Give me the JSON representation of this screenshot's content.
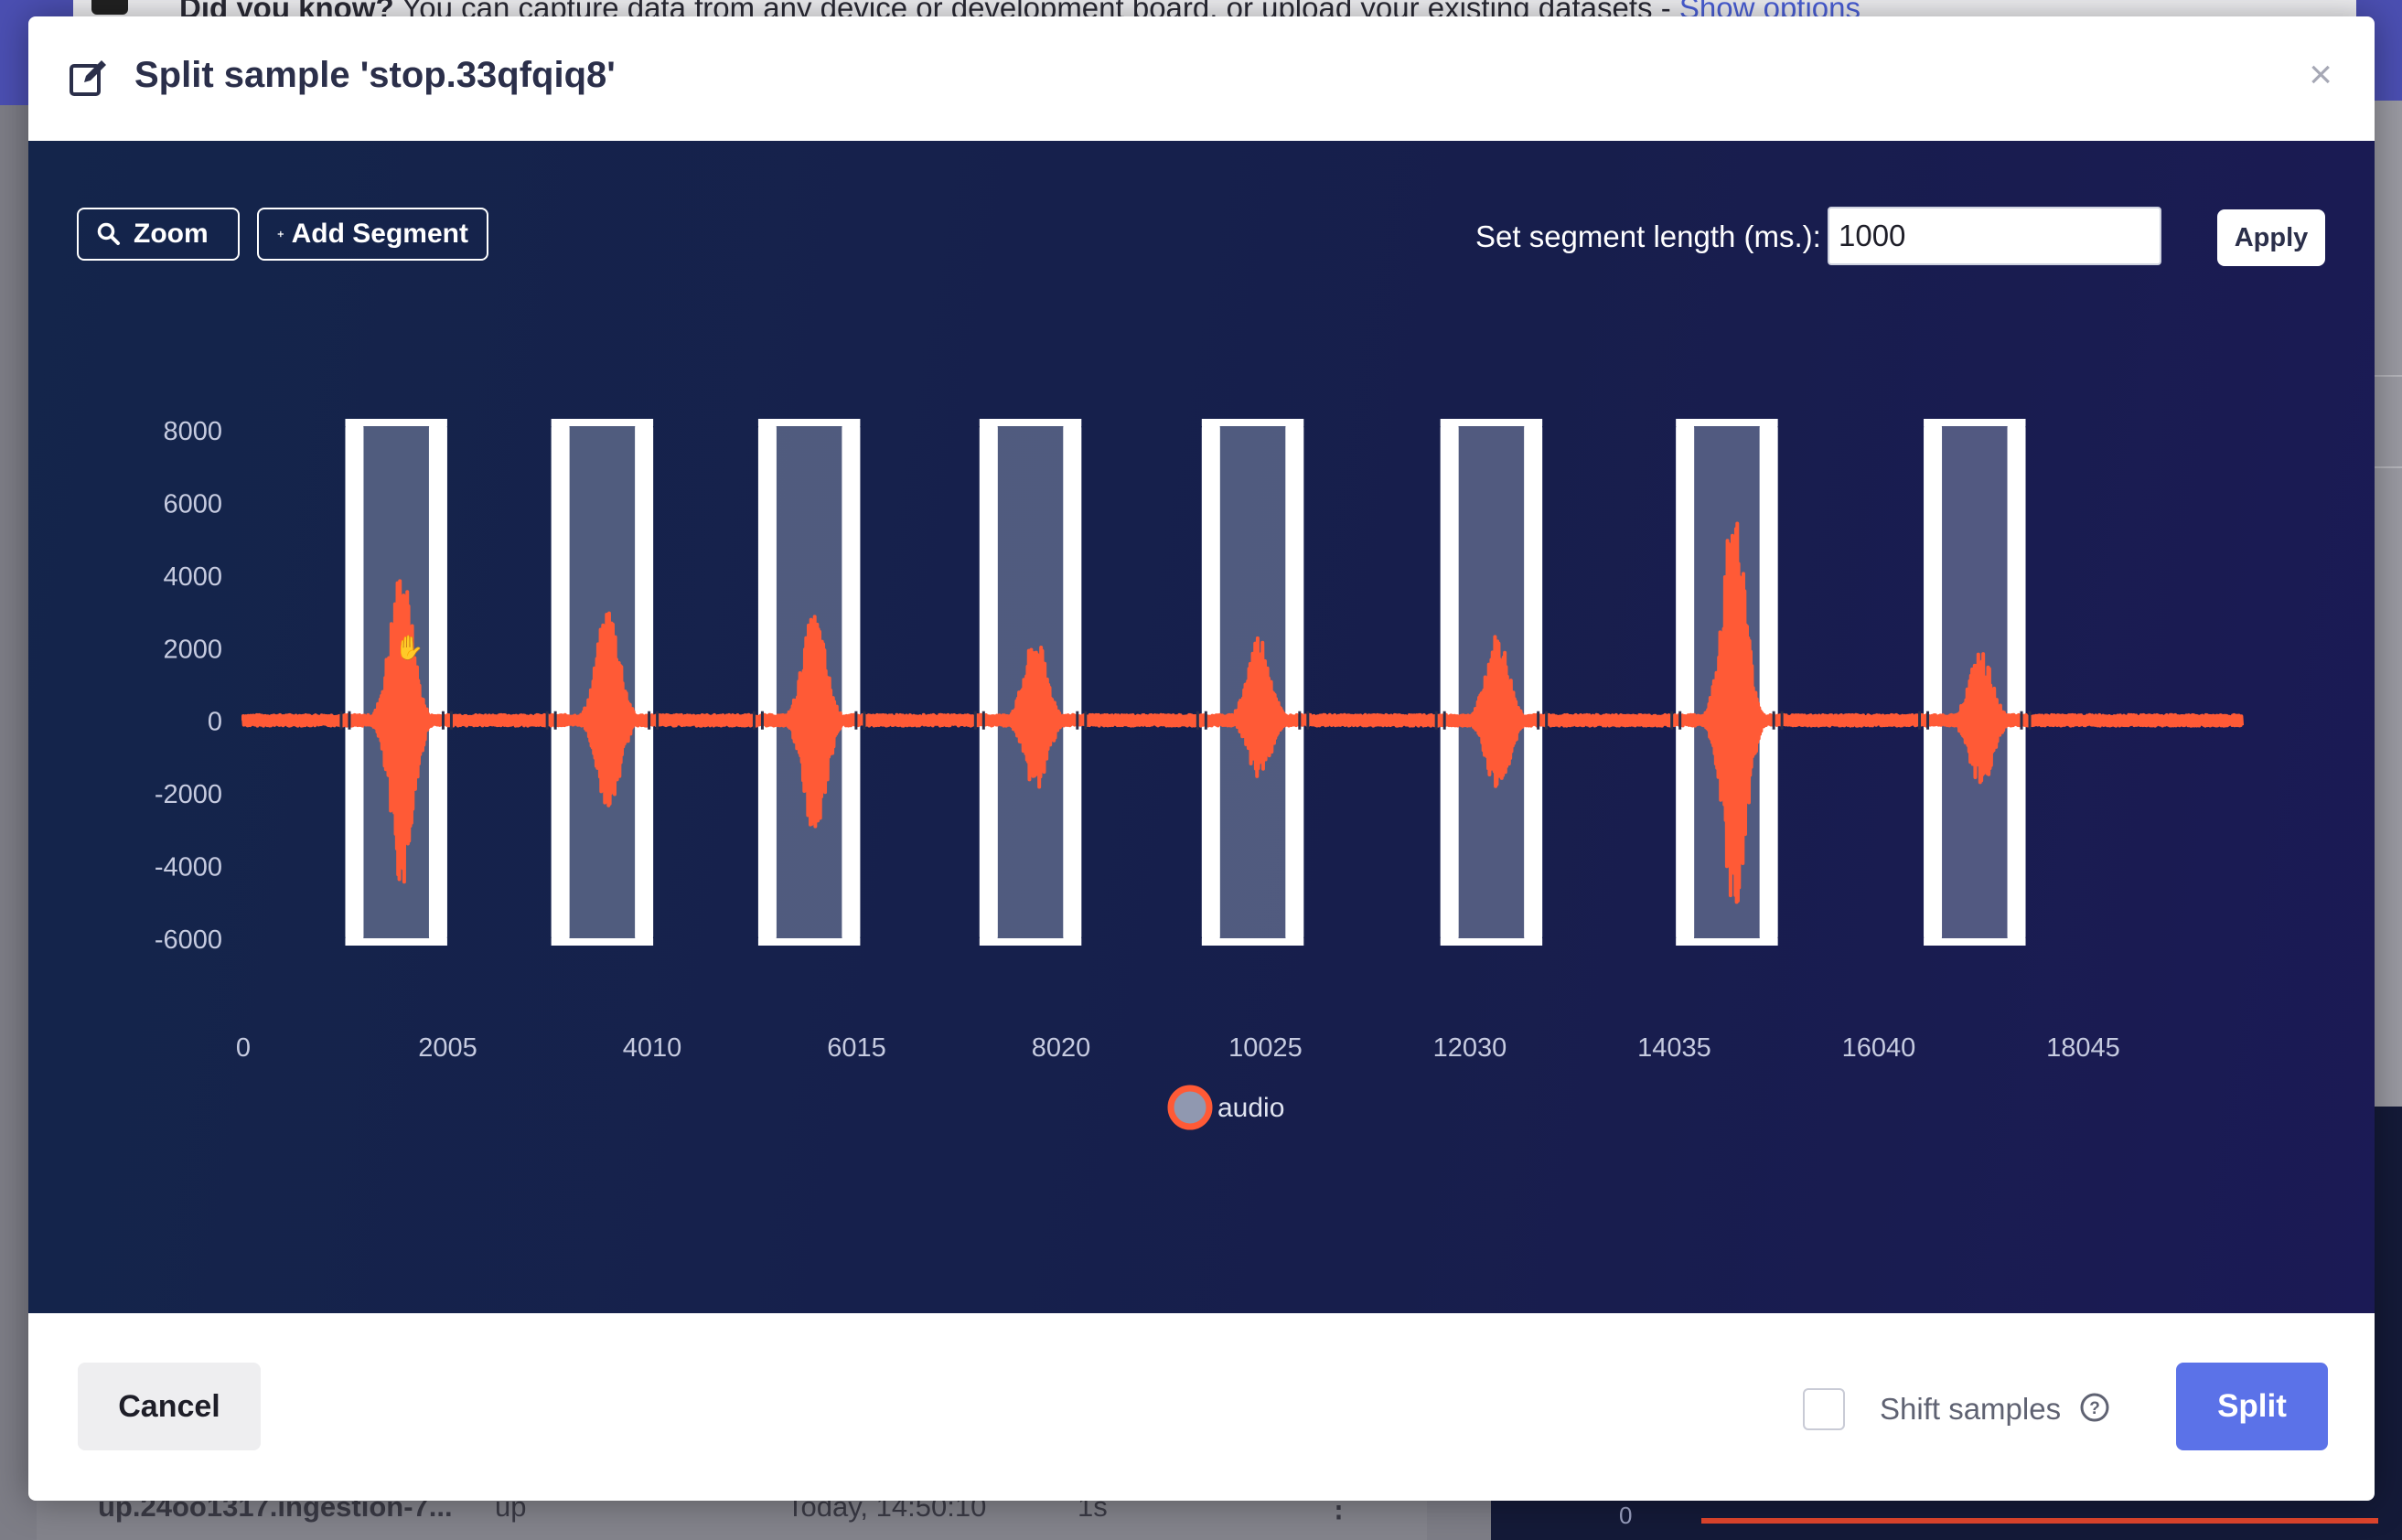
{
  "background": {
    "notice_bold": "Did you know?",
    "notice_text": " You can capture data from any device or development board, or upload your existing datasets - ",
    "notice_link": "Show options",
    "row": {
      "name": "up.24oo1317.ingestion-7...",
      "label": "up",
      "added": "Today, 14:50:10",
      "length": "1s"
    },
    "mini_chart_zero": "0"
  },
  "modal": {
    "title": "Split sample 'stop.33qfqiq8'",
    "close_label": "×",
    "edit_icon": "edit-icon",
    "toolbar": {
      "zoom_label": "Zoom",
      "zoom_icon": "search-icon",
      "add_segment_label": "Add Segment",
      "add_segment_icon": "plus-icon",
      "segment_length_label": "Set segment length (ms.):",
      "segment_length_value": "1000",
      "apply_label": "Apply"
    },
    "footer": {
      "cancel_label": "Cancel",
      "shift_samples_label": "Shift samples",
      "shift_samples_checked": false,
      "help_icon": "question-circle-icon",
      "split_label": "Split"
    }
  },
  "chart_data": {
    "type": "line",
    "series": [
      {
        "name": "audio",
        "color": "#ff5a36",
        "bursts": [
          {
            "x": 1550,
            "max": 4200,
            "min": -4600
          },
          {
            "x": 3580,
            "max": 3200,
            "min": -2500
          },
          {
            "x": 5600,
            "max": 3000,
            "min": -3300
          },
          {
            "x": 7770,
            "max": 2300,
            "min": -2000
          },
          {
            "x": 9960,
            "max": 2400,
            "min": -1600
          },
          {
            "x": 12300,
            "max": 2400,
            "min": -2000
          },
          {
            "x": 14620,
            "max": 6000,
            "min": -5400
          },
          {
            "x": 17040,
            "max": 1900,
            "min": -2000
          }
        ],
        "baseline_amplitude": 150
      }
    ],
    "x_ticks": [
      "0",
      "2005",
      "4010",
      "6015",
      "8020",
      "10025",
      "12030",
      "14035",
      "16040",
      "18045"
    ],
    "y_ticks": [
      "8000",
      "6000",
      "4000",
      "2000",
      "0",
      "-2000",
      "-4000",
      "-6000"
    ],
    "xlim": [
      0,
      20050
    ],
    "ylim": [
      -6000,
      8000
    ],
    "segments": [
      [
        1000,
        2000
      ],
      [
        3020,
        4020
      ],
      [
        5050,
        6050
      ],
      [
        7220,
        8220
      ],
      [
        9400,
        10400
      ],
      [
        11740,
        12740
      ],
      [
        14050,
        15050
      ],
      [
        16480,
        17480
      ]
    ],
    "legend": {
      "label": "audio",
      "position": "bottom-center"
    }
  }
}
